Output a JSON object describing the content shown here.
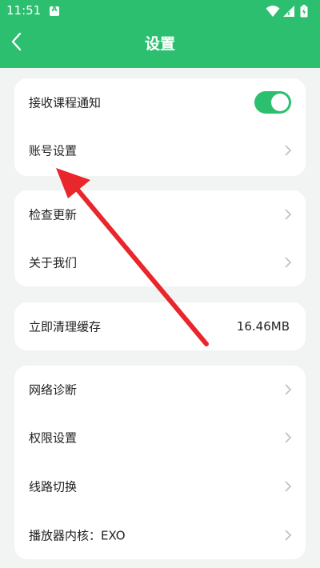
{
  "status_bar": {
    "time": "11:51",
    "notification_badge": "A",
    "icons": [
      "wifi-icon",
      "signal-icon",
      "battery-icon"
    ]
  },
  "header": {
    "title": "设置",
    "back_icon": "chevron-left-icon"
  },
  "groups": [
    {
      "items": [
        {
          "label": "接收课程通知",
          "control": "toggle",
          "toggle_on": true
        },
        {
          "label": "账号设置",
          "control": "chevron"
        }
      ]
    },
    {
      "items": [
        {
          "label": "检查更新",
          "control": "chevron"
        },
        {
          "label": "关于我们",
          "control": "chevron"
        }
      ]
    },
    {
      "items": [
        {
          "label": "立即清理缓存",
          "control": "value",
          "value": "16.46MB"
        }
      ]
    },
    {
      "items": [
        {
          "label": "网络诊断",
          "control": "chevron"
        },
        {
          "label": "权限设置",
          "control": "chevron"
        },
        {
          "label": "线路切换",
          "control": "chevron"
        },
        {
          "label": "播放器内核：EXO",
          "control": "chevron"
        }
      ]
    }
  ],
  "colors": {
    "accent": "#2bbf6f",
    "background": "#f2f4f3",
    "annotation_arrow": "#e8262b"
  }
}
